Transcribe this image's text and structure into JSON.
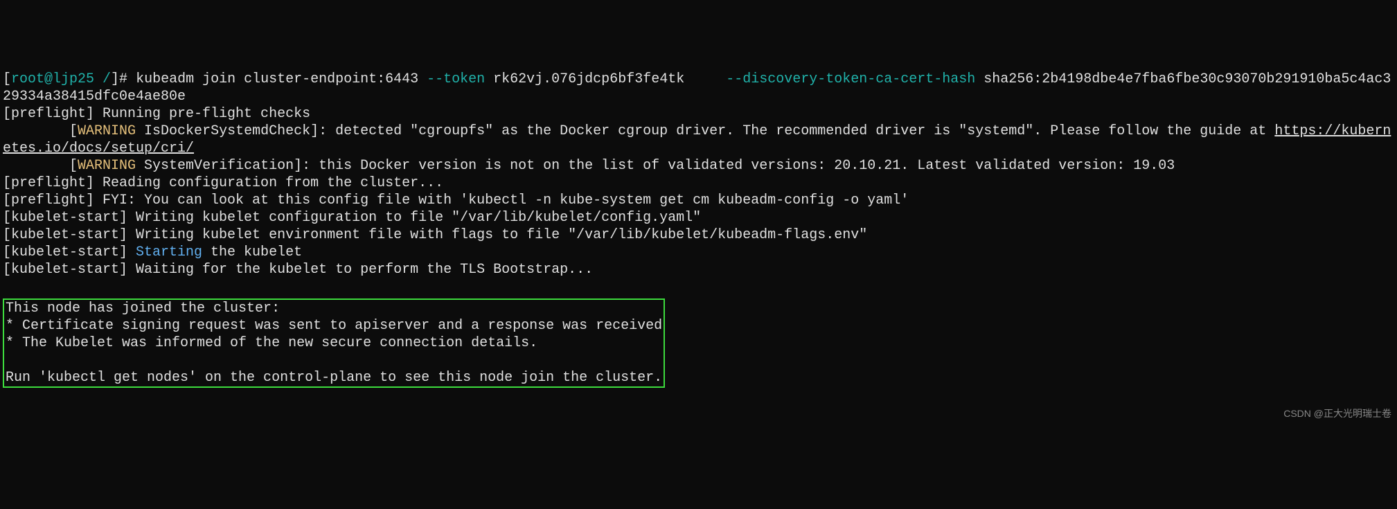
{
  "prompt": {
    "bracket_open": "[",
    "user_host": "root@ljp25 /",
    "bracket_close": "]# ",
    "cmd_prefix": "kubeadm join cluster-endpoint:6443 ",
    "flag_token": "--token",
    "token_val": " rk62vj.076jdcp6bf3fe4tk     ",
    "flag_hash": "--discovery-token-ca-cert-hash",
    "hash_val": " sha256:2b4198dbe4e7fba6fbe30c93070b291910ba5c4ac329334a38415dfc0e4ae80e"
  },
  "lines": {
    "l1": "[preflight] Running pre-flight checks",
    "l2a": "        [",
    "l2warn": "WARNING",
    "l2b": " IsDockerSystemdCheck]: detected \"cgroupfs\" as the Docker cgroup driver. The recommended driver is \"systemd\". Please follow the guide at ",
    "l2link": "https://kubernetes.io/docs/setup/cri/",
    "l3a": "        [",
    "l3warn": "WARNING",
    "l3b": " SystemVerification]: this Docker version is not on the list of validated versions: 20.10.21. Latest validated version: 19.03",
    "l4": "[preflight] Reading configuration from the cluster...",
    "l5": "[preflight] FYI: You can look at this config file with 'kubectl -n kube-system get cm kubeadm-config -o yaml'",
    "l6": "[kubelet-start] Writing kubelet configuration to file \"/var/lib/kubelet/config.yaml\"",
    "l7": "[kubelet-start] Writing kubelet environment file with flags to file \"/var/lib/kubelet/kubeadm-flags.env\"",
    "l8a": "[kubelet-start] ",
    "l8blue": "Starting",
    "l8b": " the kubelet",
    "l9": "[kubelet-start] Waiting for the kubelet to perform the TLS Bootstrap..."
  },
  "box": {
    "b1": "This node has joined the cluster:",
    "b2": "* Certificate signing request was sent to apiserver and a response was received",
    "b3": "* The Kubelet was informed of the new secure connection details.",
    "b4": "",
    "b5": "Run 'kubectl get nodes' on the control-plane to see this node join the cluster."
  },
  "watermark": "CSDN @正大光明瑞士卷"
}
